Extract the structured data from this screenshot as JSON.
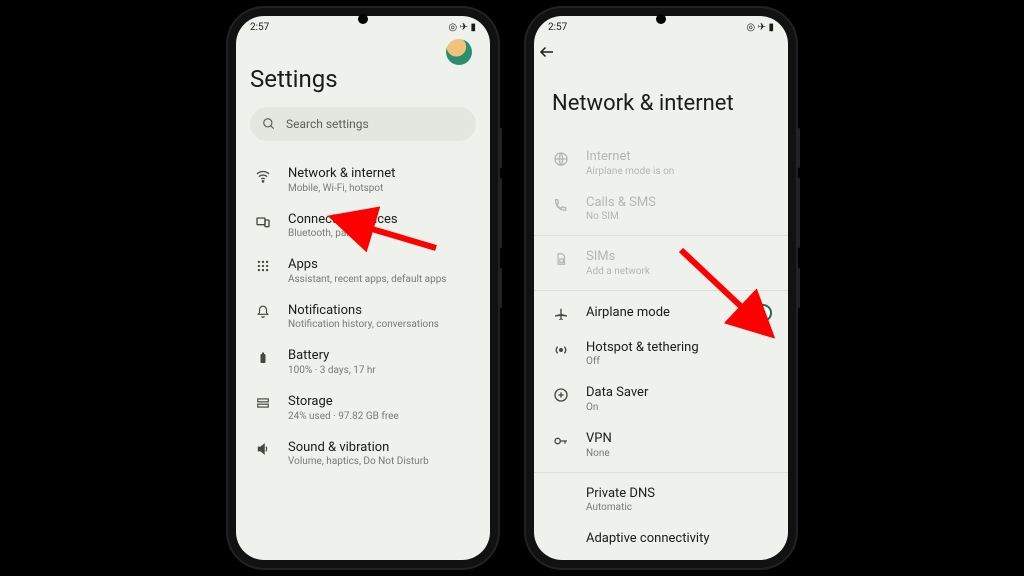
{
  "status": {
    "time": "2:57",
    "icons": "◎ ✈ ▮"
  },
  "phone1": {
    "title": "Settings",
    "search_placeholder": "Search settings",
    "rows": [
      {
        "label": "Network & internet",
        "sub": "Mobile, Wi-Fi, hotspot"
      },
      {
        "label": "Connected devices",
        "sub": "Bluetooth, pairing"
      },
      {
        "label": "Apps",
        "sub": "Assistant, recent apps, default apps"
      },
      {
        "label": "Notifications",
        "sub": "Notification history, conversations"
      },
      {
        "label": "Battery",
        "sub": "100% · 3 days, 17 hr"
      },
      {
        "label": "Storage",
        "sub": "24% used · 97.82 GB free"
      },
      {
        "label": "Sound & vibration",
        "sub": "Volume, haptics, Do Not Disturb"
      }
    ]
  },
  "phone2": {
    "title": "Network & internet",
    "rows": [
      {
        "label": "Internet",
        "sub": "Airplane mode is on",
        "disabled": true
      },
      {
        "label": "Calls & SMS",
        "sub": "No SIM",
        "disabled": true
      },
      {
        "label": "SIMs",
        "sub": "Add a network",
        "disabled": true
      },
      {
        "label": "Airplane mode",
        "toggle": true
      },
      {
        "label": "Hotspot & tethering",
        "sub": "Off"
      },
      {
        "label": "Data Saver",
        "sub": "On"
      },
      {
        "label": "VPN",
        "sub": "None"
      },
      {
        "label": "Private DNS",
        "sub": "Automatic",
        "noicon": true
      },
      {
        "label": "Adaptive connectivity",
        "noicon": true
      }
    ]
  }
}
